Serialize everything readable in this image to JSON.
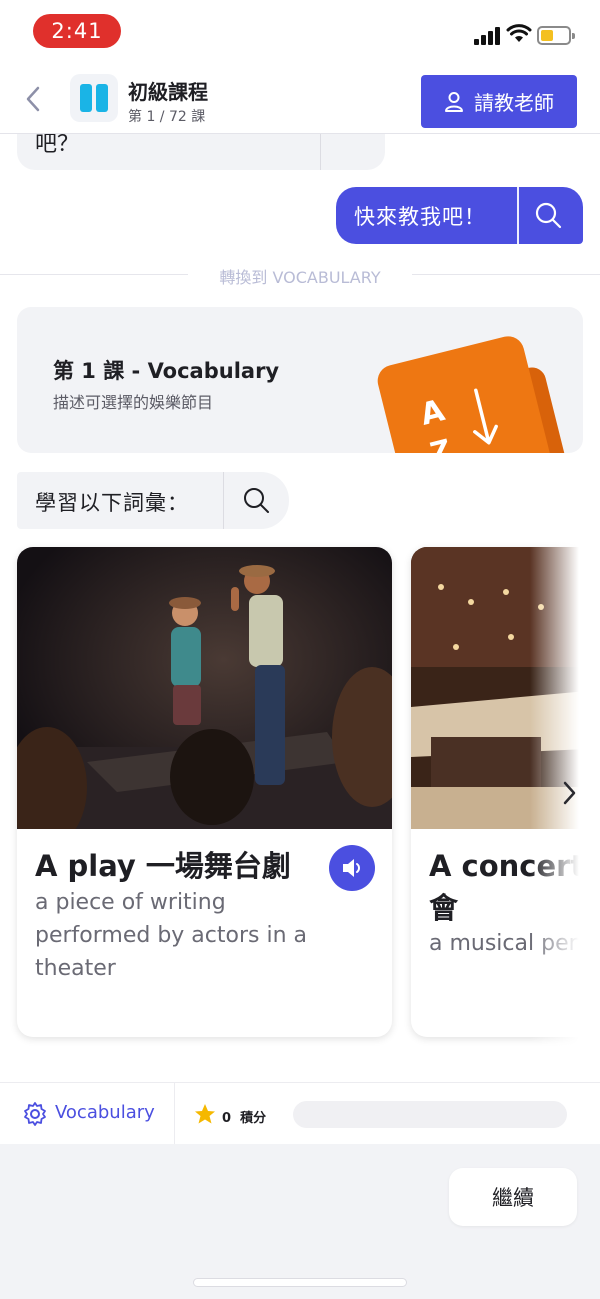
{
  "status_bar": {
    "time": "2:41",
    "battery_color": "#f4c020"
  },
  "header": {
    "back_icon": "chevron-left-icon",
    "logo_icon": "app-logo",
    "course_title": "初級課程",
    "course_subtitle": "第 1 / 72 課",
    "teacher_button": "請教老師",
    "teacher_icon": "person-icon",
    "accent_color": "#4b4fe0"
  },
  "chat": {
    "partial_message": "吧？",
    "user_message": "快來教我吧！",
    "switch_label": "轉換到 VOCABULARY"
  },
  "lesson": {
    "title": "第 1 課 - Vocabulary",
    "subtitle": "描述可選擇的娛樂節目",
    "card_letter_top": "A",
    "card_letter_bottom": "Z",
    "card_color": "#ee7712"
  },
  "learn": {
    "label": "學習以下詞彙："
  },
  "vocab_cards": [
    {
      "word": "A play 一場舞台劇",
      "definition_lines": [
        "a piece of writing",
        "performed by actors in a",
        "theater"
      ]
    },
    {
      "word_line1": "A concert 一",
      "word_line2": "會",
      "definition_lines": [
        "a musical perfor"
      ]
    }
  ],
  "bottom_bar": {
    "mode_label": "Vocabulary",
    "points_value": "0",
    "points_label": "積分",
    "progress": 0
  },
  "footer": {
    "continue_button": "繼續"
  }
}
